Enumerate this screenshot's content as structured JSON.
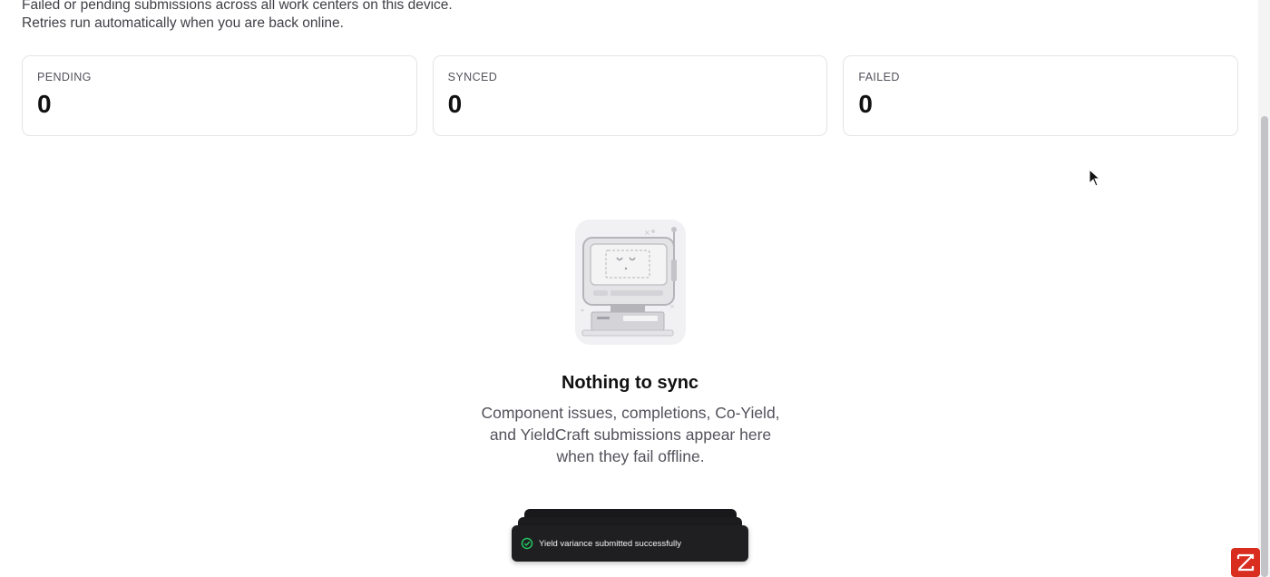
{
  "header": {
    "subtitle_line1": "Failed or pending submissions across all work centers on this device.",
    "subtitle_line2": "Retries run automatically when you are back online."
  },
  "stats": [
    {
      "label": "PENDING",
      "value": "0"
    },
    {
      "label": "SYNCED",
      "value": "0"
    },
    {
      "label": "FAILED",
      "value": "0"
    }
  ],
  "empty_state": {
    "illustration": "offline-computer-illustration",
    "title": "Nothing to sync",
    "description": "Component issues, completions, Co-Yield, and YieldCraft submissions appear here when they fail offline."
  },
  "toast": {
    "icon": "check-circle-icon",
    "message": "Yield variance submitted successfully",
    "color": "#22c55e"
  },
  "corner_badge": {
    "icon": "brand-logo-icon",
    "color": "#d92d20"
  }
}
